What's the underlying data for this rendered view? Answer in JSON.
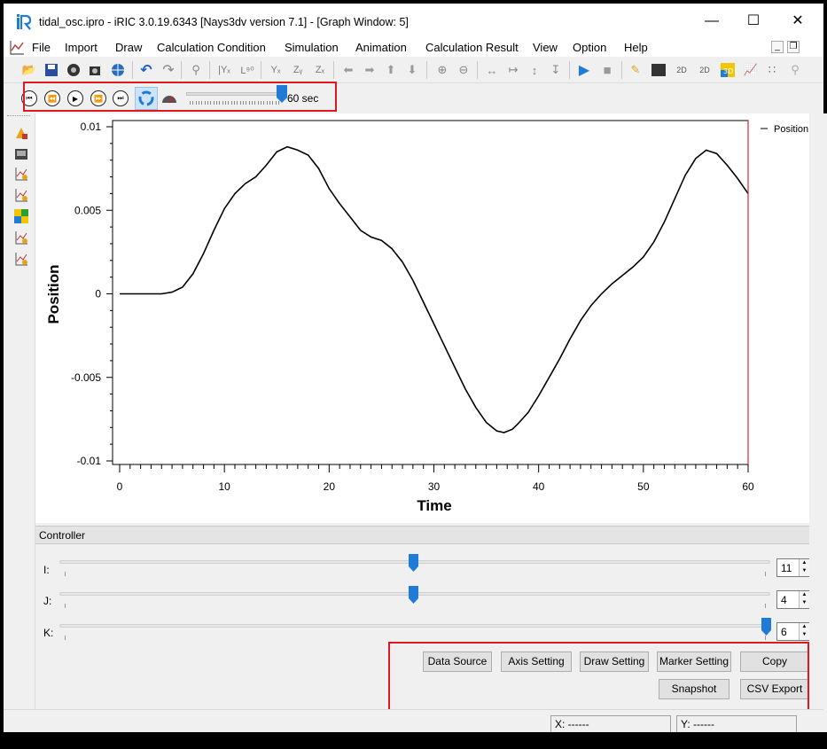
{
  "window": {
    "title": "tidal_osc.ipro - iRIC 3.0.19.6343 [Nays3dv version 7.1] - [Graph Window: 5]",
    "minimize": "—",
    "maximize": "☐",
    "close": "✕"
  },
  "menu": {
    "items": [
      "File",
      "Import",
      "Draw",
      "Calculation Condition",
      "Simulation",
      "Animation",
      "Calculation Result",
      "View",
      "Option",
      "Help"
    ],
    "mdi_minimize": "_",
    "mdi_restore": "❐"
  },
  "animation": {
    "time_label": "60 sec",
    "slider_fraction": 1.0
  },
  "chart_data": {
    "type": "line",
    "xlabel": "Time",
    "ylabel": "Position",
    "xlim": [
      0,
      60
    ],
    "ylim": [
      -0.01,
      0.01
    ],
    "x_ticks": [
      "0",
      "10",
      "20",
      "30",
      "40",
      "50",
      "60"
    ],
    "y_ticks": [
      "0.01",
      "0.005",
      "0",
      "-0.005",
      "-0.01"
    ],
    "legend": [
      "Position"
    ],
    "legend_placement": "top-right",
    "current_time_marker": 60,
    "series": [
      {
        "name": "Position",
        "x": [
          0,
          2,
          4,
          5,
          6,
          7,
          8,
          9,
          10,
          11,
          12,
          13,
          14,
          15,
          16,
          17,
          18,
          19,
          20,
          21,
          22,
          23,
          24,
          25,
          26,
          27,
          28,
          29,
          30,
          31,
          32,
          33,
          34,
          35,
          36,
          36.7,
          37.5,
          38,
          39,
          40,
          41,
          42,
          43,
          44,
          45,
          46,
          47,
          48,
          49,
          50,
          51,
          52,
          53,
          54,
          55,
          56,
          57,
          58,
          59,
          60
        ],
        "y": [
          0,
          0,
          0,
          0.0001,
          0.0004,
          0.0012,
          0.0024,
          0.0038,
          0.0051,
          0.006,
          0.0066,
          0.007,
          0.0077,
          0.0085,
          0.0088,
          0.0086,
          0.0083,
          0.0075,
          0.0063,
          0.0054,
          0.0046,
          0.0038,
          0.0034,
          0.0032,
          0.0027,
          0.0019,
          0.0008,
          -0.0005,
          -0.0018,
          -0.0031,
          -0.0044,
          -0.0057,
          -0.0068,
          -0.0077,
          -0.0082,
          -0.0083,
          -0.0081,
          -0.0078,
          -0.0071,
          -0.0061,
          -0.005,
          -0.0039,
          -0.0027,
          -0.0016,
          -0.0007,
          0.0,
          0.0006,
          0.0011,
          0.0016,
          0.0022,
          0.0031,
          0.0043,
          0.0057,
          0.0071,
          0.0081,
          0.0086,
          0.0084,
          0.0077,
          0.0069,
          0.006
        ]
      }
    ]
  },
  "controller": {
    "header": "Controller",
    "sliders": [
      {
        "label": "I:",
        "value": "11",
        "fraction": 0.5
      },
      {
        "label": "J:",
        "value": "4",
        "fraction": 0.5
      },
      {
        "label": "K:",
        "value": "6",
        "fraction": 1.0
      }
    ],
    "buttons": {
      "data_source": "Data Source",
      "axis_setting": "Axis Setting",
      "draw_setting": "Draw Setting",
      "marker_setting": "Marker Setting",
      "copy": "Copy",
      "snapshot": "Snapshot",
      "csv_export": "CSV Export"
    }
  },
  "status": {
    "x": "X: ------",
    "y": "Y: ------"
  },
  "colors": {
    "highlight": "#e0191e",
    "accent": "#1f7bd6",
    "curve": "#000000",
    "time_line": "#d62728"
  }
}
